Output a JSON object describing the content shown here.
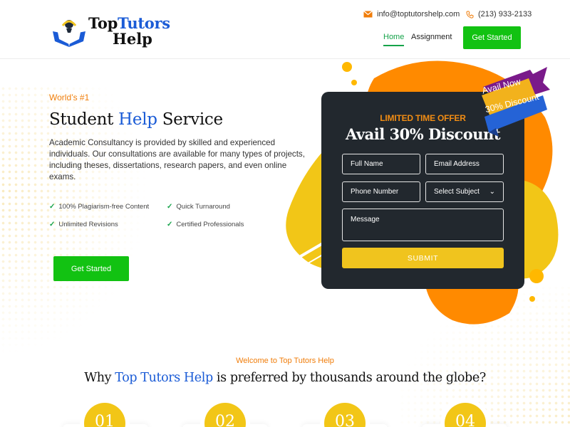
{
  "header": {
    "logo": {
      "top": "Top",
      "tutors": "Tutors",
      "bottom": "Help"
    },
    "email": "info@toptutorshelp.com",
    "phone": "(213) 933-2133",
    "nav": [
      {
        "label": "Home",
        "active": true
      },
      {
        "label": "Assignment",
        "active": false
      }
    ],
    "cta_label": "Get Started"
  },
  "hero": {
    "kicker": "World’s #1",
    "title": {
      "part1": "Student ",
      "highlight": "Help",
      "part2": " Service"
    },
    "description": "Academic Consultancy is provided by skilled and experienced individuals. Our consultations are available for many types of projects, including theses, dissertations, research papers, and even online exams.",
    "features": [
      "100% Plagiarism-free Content",
      "Quick Turnaround",
      "Unlimited Revisions",
      "Certified Professionals"
    ],
    "cta_label": "Get Started"
  },
  "form": {
    "offer_label": "LIMITED TIME OFFER",
    "title": "Avail 30% Discount",
    "ribbon_line1": "Avail Now",
    "ribbon_line2": "30% Discount",
    "full_name_placeholder": "Full Name",
    "email_placeholder": "Email Address",
    "phone_placeholder": "Phone Number",
    "subject_selected": "Select Subject",
    "message_placeholder": "Message",
    "submit_label": "SUBMIT"
  },
  "section": {
    "kicker": "Welcome to Top Tutors Help",
    "title": {
      "part1": "Why ",
      "highlight": "Top Tutors Help",
      "part2": " is preferred by thousands around the globe?"
    },
    "steps": [
      "01",
      "02",
      "03",
      "04"
    ]
  },
  "colors": {
    "accent_green": "#12c212",
    "accent_blue": "#1a5bd6",
    "accent_orange": "#f07d0a",
    "accent_yellow": "#f0c41e",
    "card_dark": "#22282e"
  }
}
